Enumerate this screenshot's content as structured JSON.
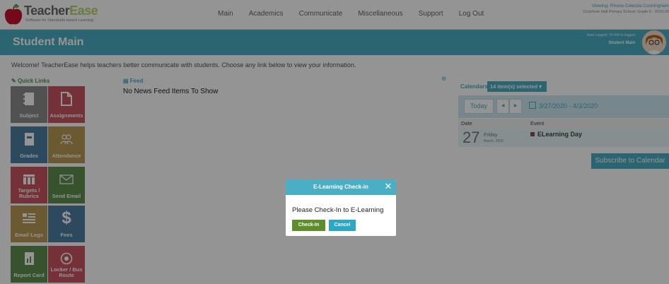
{
  "brand": {
    "name_part1": "Teacher",
    "name_part2": "Ease",
    "tagline": "Software for Standards-based Learning"
  },
  "nav": [
    "Main",
    "Academics",
    "Communicate",
    "Miscellaneous",
    "Support",
    "Log Out"
  ],
  "viewing": {
    "line1": "Viewing: Rhona Celestia Cunningham",
    "line2": "Crutchum Hall Primary School, Grade 5 - 2019-20"
  },
  "header": {
    "title": "Student Main",
    "logged_in": "Auto Logged: Yo Wei is logged",
    "student_main_label": "Student Main"
  },
  "welcome": "Welcome! TeacherEase helps teachers better communicate with students. Choose any link below to view your information.",
  "quick_links": {
    "heading": "Quick Links",
    "items": [
      {
        "label": "Subject"
      },
      {
        "label": "Assignments"
      },
      {
        "label": "Grades"
      },
      {
        "label": "Attendance"
      },
      {
        "label": "Targets / Rubrics"
      },
      {
        "label": "Send Email"
      },
      {
        "label": "Email Logs"
      },
      {
        "label": "Fees"
      },
      {
        "label": "Report Card"
      },
      {
        "label": "Locker / Bus Route"
      }
    ]
  },
  "feed": {
    "heading": "Feed",
    "empty_text": "No News Feed Items To Show"
  },
  "calendar": {
    "label": "Calendars:",
    "selected": "14 item(s) selected",
    "today": "Today",
    "prev": "◀",
    "next": "▶",
    "range": "3/27/2020 - 4/3/2020",
    "col_date": "Date",
    "col_event": "Event",
    "day_number": "27",
    "day_name": "Friday",
    "day_month": "March, 2020",
    "event_name": "ELearning Day",
    "subscribe": "Subscribe to Calendar"
  },
  "modal": {
    "title": "E-Learning Check-in",
    "close": "✕",
    "message": "Please Check-In to E-Learning",
    "checkin_label": "Check-In",
    "cancel_label": "Cancel"
  },
  "colors": {
    "accent": "#4aaec4",
    "checkin": "#5e8e2b",
    "cancel": "#2ba8c6"
  }
}
